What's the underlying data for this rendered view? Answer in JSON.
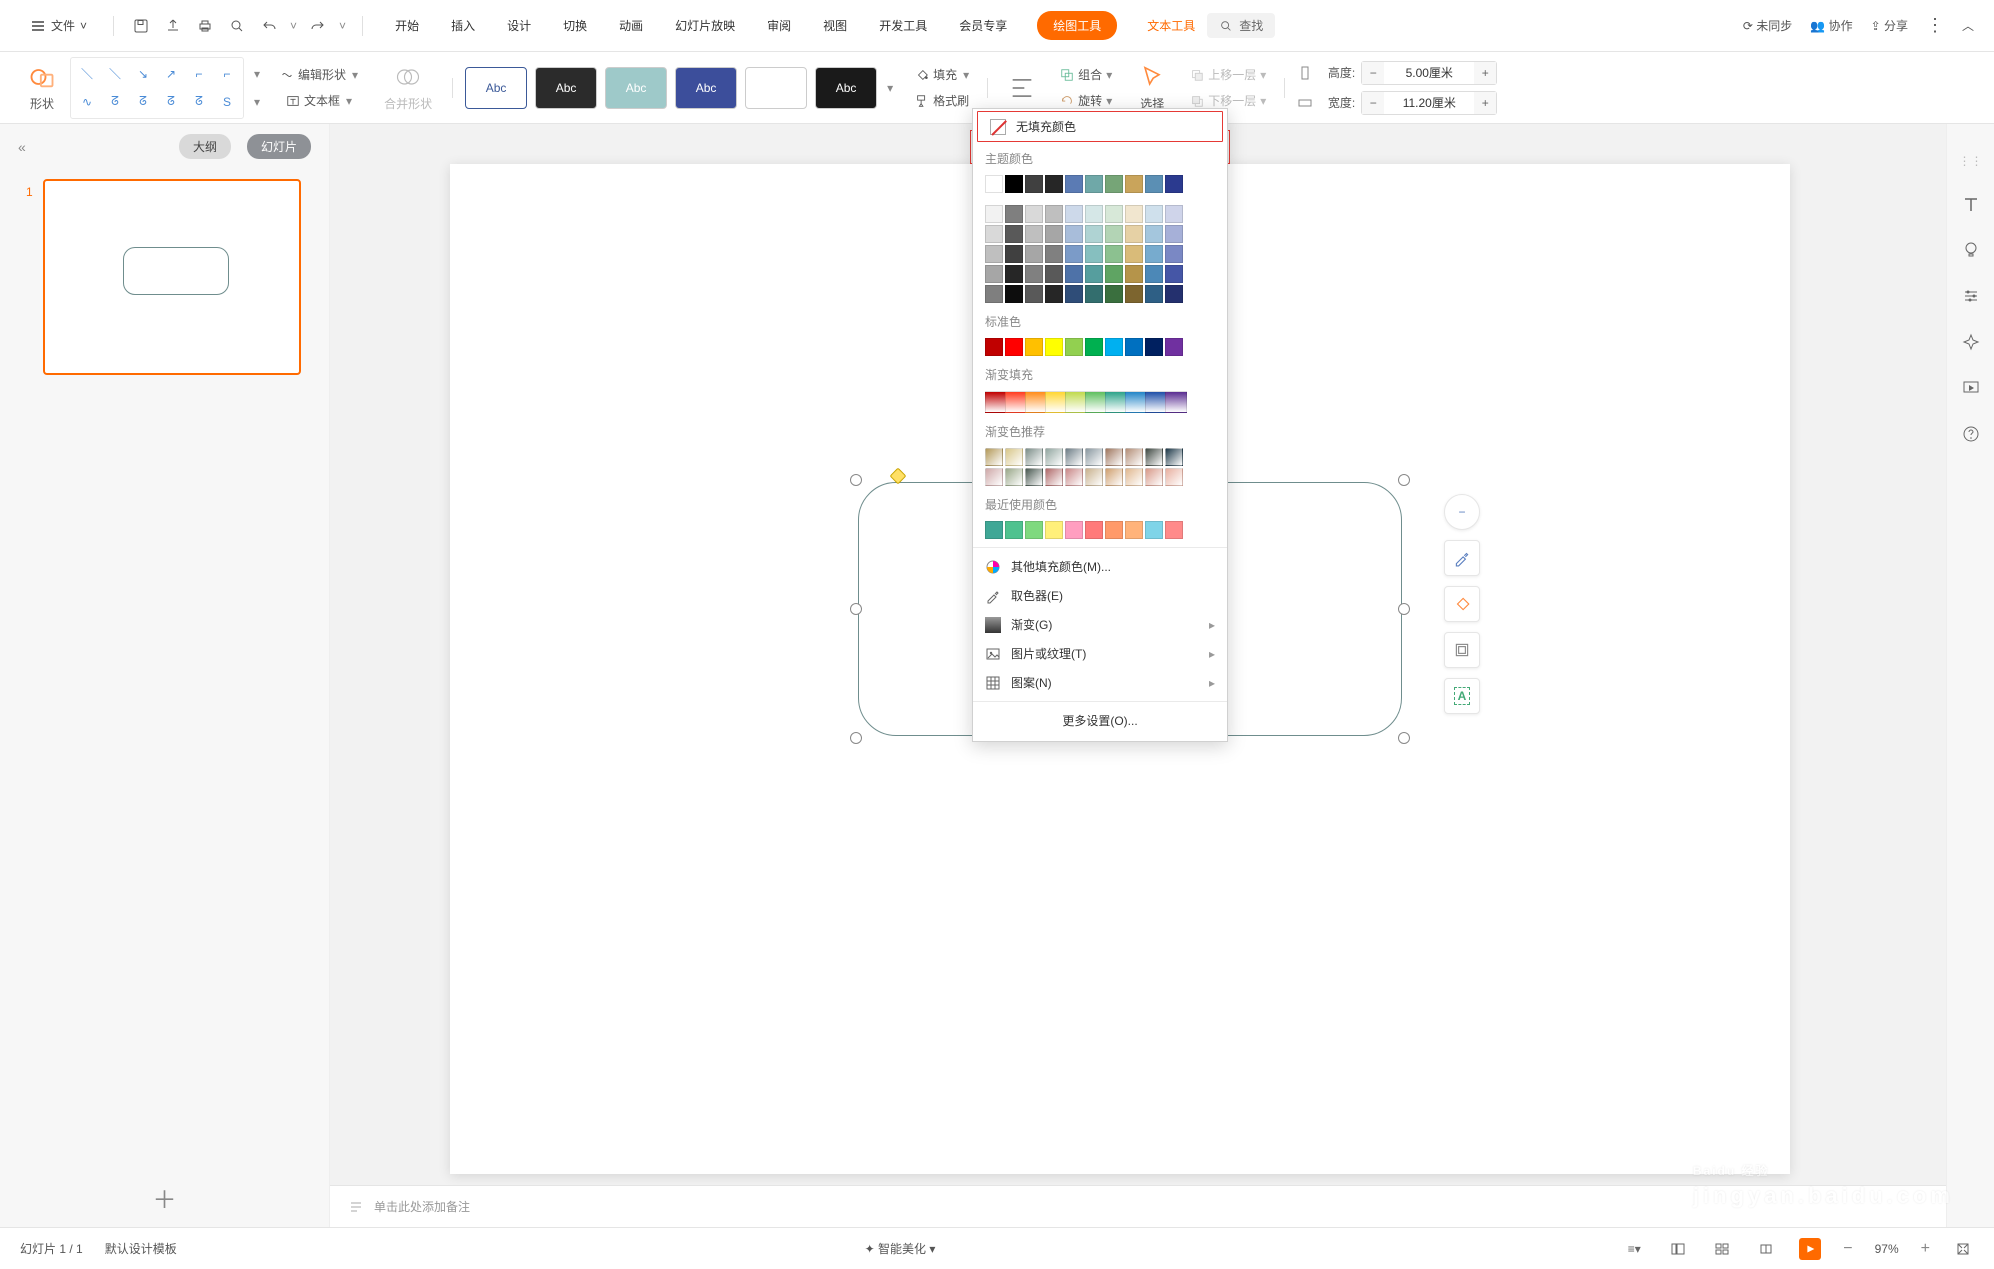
{
  "app": {
    "file_menu": "文件",
    "tabs": [
      "开始",
      "插入",
      "设计",
      "切换",
      "动画",
      "幻灯片放映",
      "审阅",
      "视图",
      "开发工具",
      "会员专享",
      "绘图工具",
      "文本工具"
    ],
    "active_tab_index": 10,
    "accent_tab_index": 11,
    "search_placeholder": "查找",
    "sync": "未同步",
    "collab": "协作",
    "share": "分享"
  },
  "ribbon": {
    "shape_btn": "形状",
    "edit_shape": "编辑形状",
    "text_box": "文本框",
    "merge_shape": "合并形状",
    "style_label": "Abc",
    "fill": "填充",
    "format_painter": "格式刷",
    "group": "组合",
    "rotate": "旋转",
    "select": "选择",
    "bring_forward": "上移一层",
    "send_backward": "下移一层",
    "height_lbl": "高度:",
    "width_lbl": "宽度:",
    "height_val": "5.00厘米",
    "width_val": "11.20厘米"
  },
  "fill_dropdown": {
    "no_fill": "无填充颜色",
    "theme_colors": "主题颜色",
    "theme_palette_row1": [
      "#ffffff",
      "#000000",
      "#404040",
      "#262626",
      "#5b7bb4",
      "#6fa8a8",
      "#76a577",
      "#c9a45b",
      "#5b8fb4",
      "#2b3a8f"
    ],
    "theme_shades": [
      [
        "#f2f2f2",
        "#7f7f7f",
        "#d9d9d9",
        "#bfbfbf",
        "#cdd9ea",
        "#d5e7e7",
        "#d7e8d8",
        "#f1e6cf",
        "#cfe0ec",
        "#cfd4ea"
      ],
      [
        "#d9d9d9",
        "#595959",
        "#bfbfbf",
        "#a6a6a6",
        "#a8bdda",
        "#afd3d3",
        "#b3d4b5",
        "#e6d1a5",
        "#a4c6dd",
        "#a6b0d8"
      ],
      [
        "#bfbfbf",
        "#404040",
        "#a6a6a6",
        "#808080",
        "#7b9bc8",
        "#86bfbf",
        "#8cc190",
        "#d9bb79",
        "#77abce",
        "#7a88c4"
      ],
      [
        "#a6a6a6",
        "#262626",
        "#808080",
        "#595959",
        "#4e72a8",
        "#569e9e",
        "#5fa463",
        "#b5944a",
        "#4c88b7",
        "#4556a6"
      ],
      [
        "#7f7f7f",
        "#0d0d0d",
        "#595959",
        "#262626",
        "#2f4d78",
        "#336e6e",
        "#3a6f3e",
        "#7d652f",
        "#2e5f85",
        "#24306e"
      ]
    ],
    "standard_colors": "标准色",
    "standard_palette": [
      "#c00000",
      "#ff0000",
      "#ffc000",
      "#ffff00",
      "#92d050",
      "#00b050",
      "#00b0f0",
      "#0070c0",
      "#002060",
      "#7030a0"
    ],
    "gradient_fill": "渐变填充",
    "gradient_palette": [
      "#c00000",
      "#ff3b1f",
      "#ff8c1a",
      "#ffd633",
      "#c0d94d",
      "#5fbf5f",
      "#2ea38a",
      "#2385c7",
      "#1f4fa8",
      "#5a2d91"
    ],
    "gradient_recommend": "渐变色推荐",
    "gradient_rec_rows": [
      [
        "#b49a5b",
        "#d8c78a",
        "#7d8f8a",
        "#93a7a1",
        "#6f7f88",
        "#8b99a1",
        "#a07860",
        "#b48f78",
        "#404a44",
        "#1f3a4a"
      ],
      [
        "#cfa9a9",
        "#9aa88a",
        "#4a5a52",
        "#b06a6a",
        "#c98888",
        "#c9b28f",
        "#d0a070",
        "#e0b890",
        "#d89a8a",
        "#e8b0a0"
      ]
    ],
    "recent_colors": "最近使用颜色",
    "recent_palette": [
      "#3fa796",
      "#4fc28f",
      "#7fd97f",
      "#fff07a",
      "#ff9ec0",
      "#ff7a7a",
      "#ff9a6a",
      "#ffb37a",
      "#7fd4e8",
      "#ff8a8a"
    ],
    "more_colors": "其他填充颜色(M)...",
    "eyedropper": "取色器(E)",
    "gradient_menu": "渐变(G)",
    "picture_texture": "图片或纹理(T)",
    "pattern": "图案(N)",
    "more_settings": "更多设置(O)..."
  },
  "side": {
    "outline": "大纲",
    "slides": "幻灯片",
    "slide_num": "1"
  },
  "notes_placeholder": "单击此处添加备注",
  "status": {
    "slide_count": "幻灯片 1 / 1",
    "template": "默认设计模板",
    "beautify": "智能美化",
    "zoom": "97%"
  },
  "watermark": {
    "brand": "Baidu 经验",
    "sub": "jingyan.baidu.com"
  }
}
